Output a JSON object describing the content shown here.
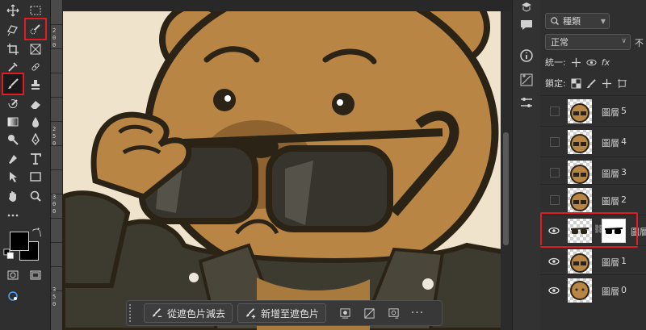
{
  "layers_panel": {
    "filter_label": "種類",
    "blend_mode": "正常",
    "opacity_label_cut": "不",
    "unify_label": "統一:",
    "lock_label": "鎖定:",
    "layers": [
      {
        "name": "圖層",
        "num": "5",
        "visible": false
      },
      {
        "name": "圖層",
        "num": "4",
        "visible": false
      },
      {
        "name": "圖層",
        "num": "3",
        "visible": false
      },
      {
        "name": "圖層",
        "num": "2",
        "visible": false
      },
      {
        "name": "圖層",
        "num": "",
        "visible": true,
        "has_mask": true,
        "selected": true
      },
      {
        "name": "圖層",
        "num": "1",
        "visible": true
      },
      {
        "name": "圖層",
        "num": "0",
        "visible": true
      }
    ]
  },
  "context_bar": {
    "subtract_label": "從遮色片減去",
    "add_label": "新增至遮色片",
    "more_label": "···"
  },
  "ruler": {
    "marks": [
      "2",
      "0",
      "0",
      "2",
      "5",
      "0",
      "3",
      "0",
      "0",
      "3",
      "5",
      "0"
    ]
  },
  "colors": {
    "highlight": "#e11c24",
    "canvas_bg": "#efe3cb",
    "bear_fur": "#b88544",
    "outline": "#2b2416"
  },
  "icons": {
    "selected_tool": "brush-icon",
    "highlighted_tools": [
      "quick-selection-icon",
      "brush-icon"
    ]
  }
}
